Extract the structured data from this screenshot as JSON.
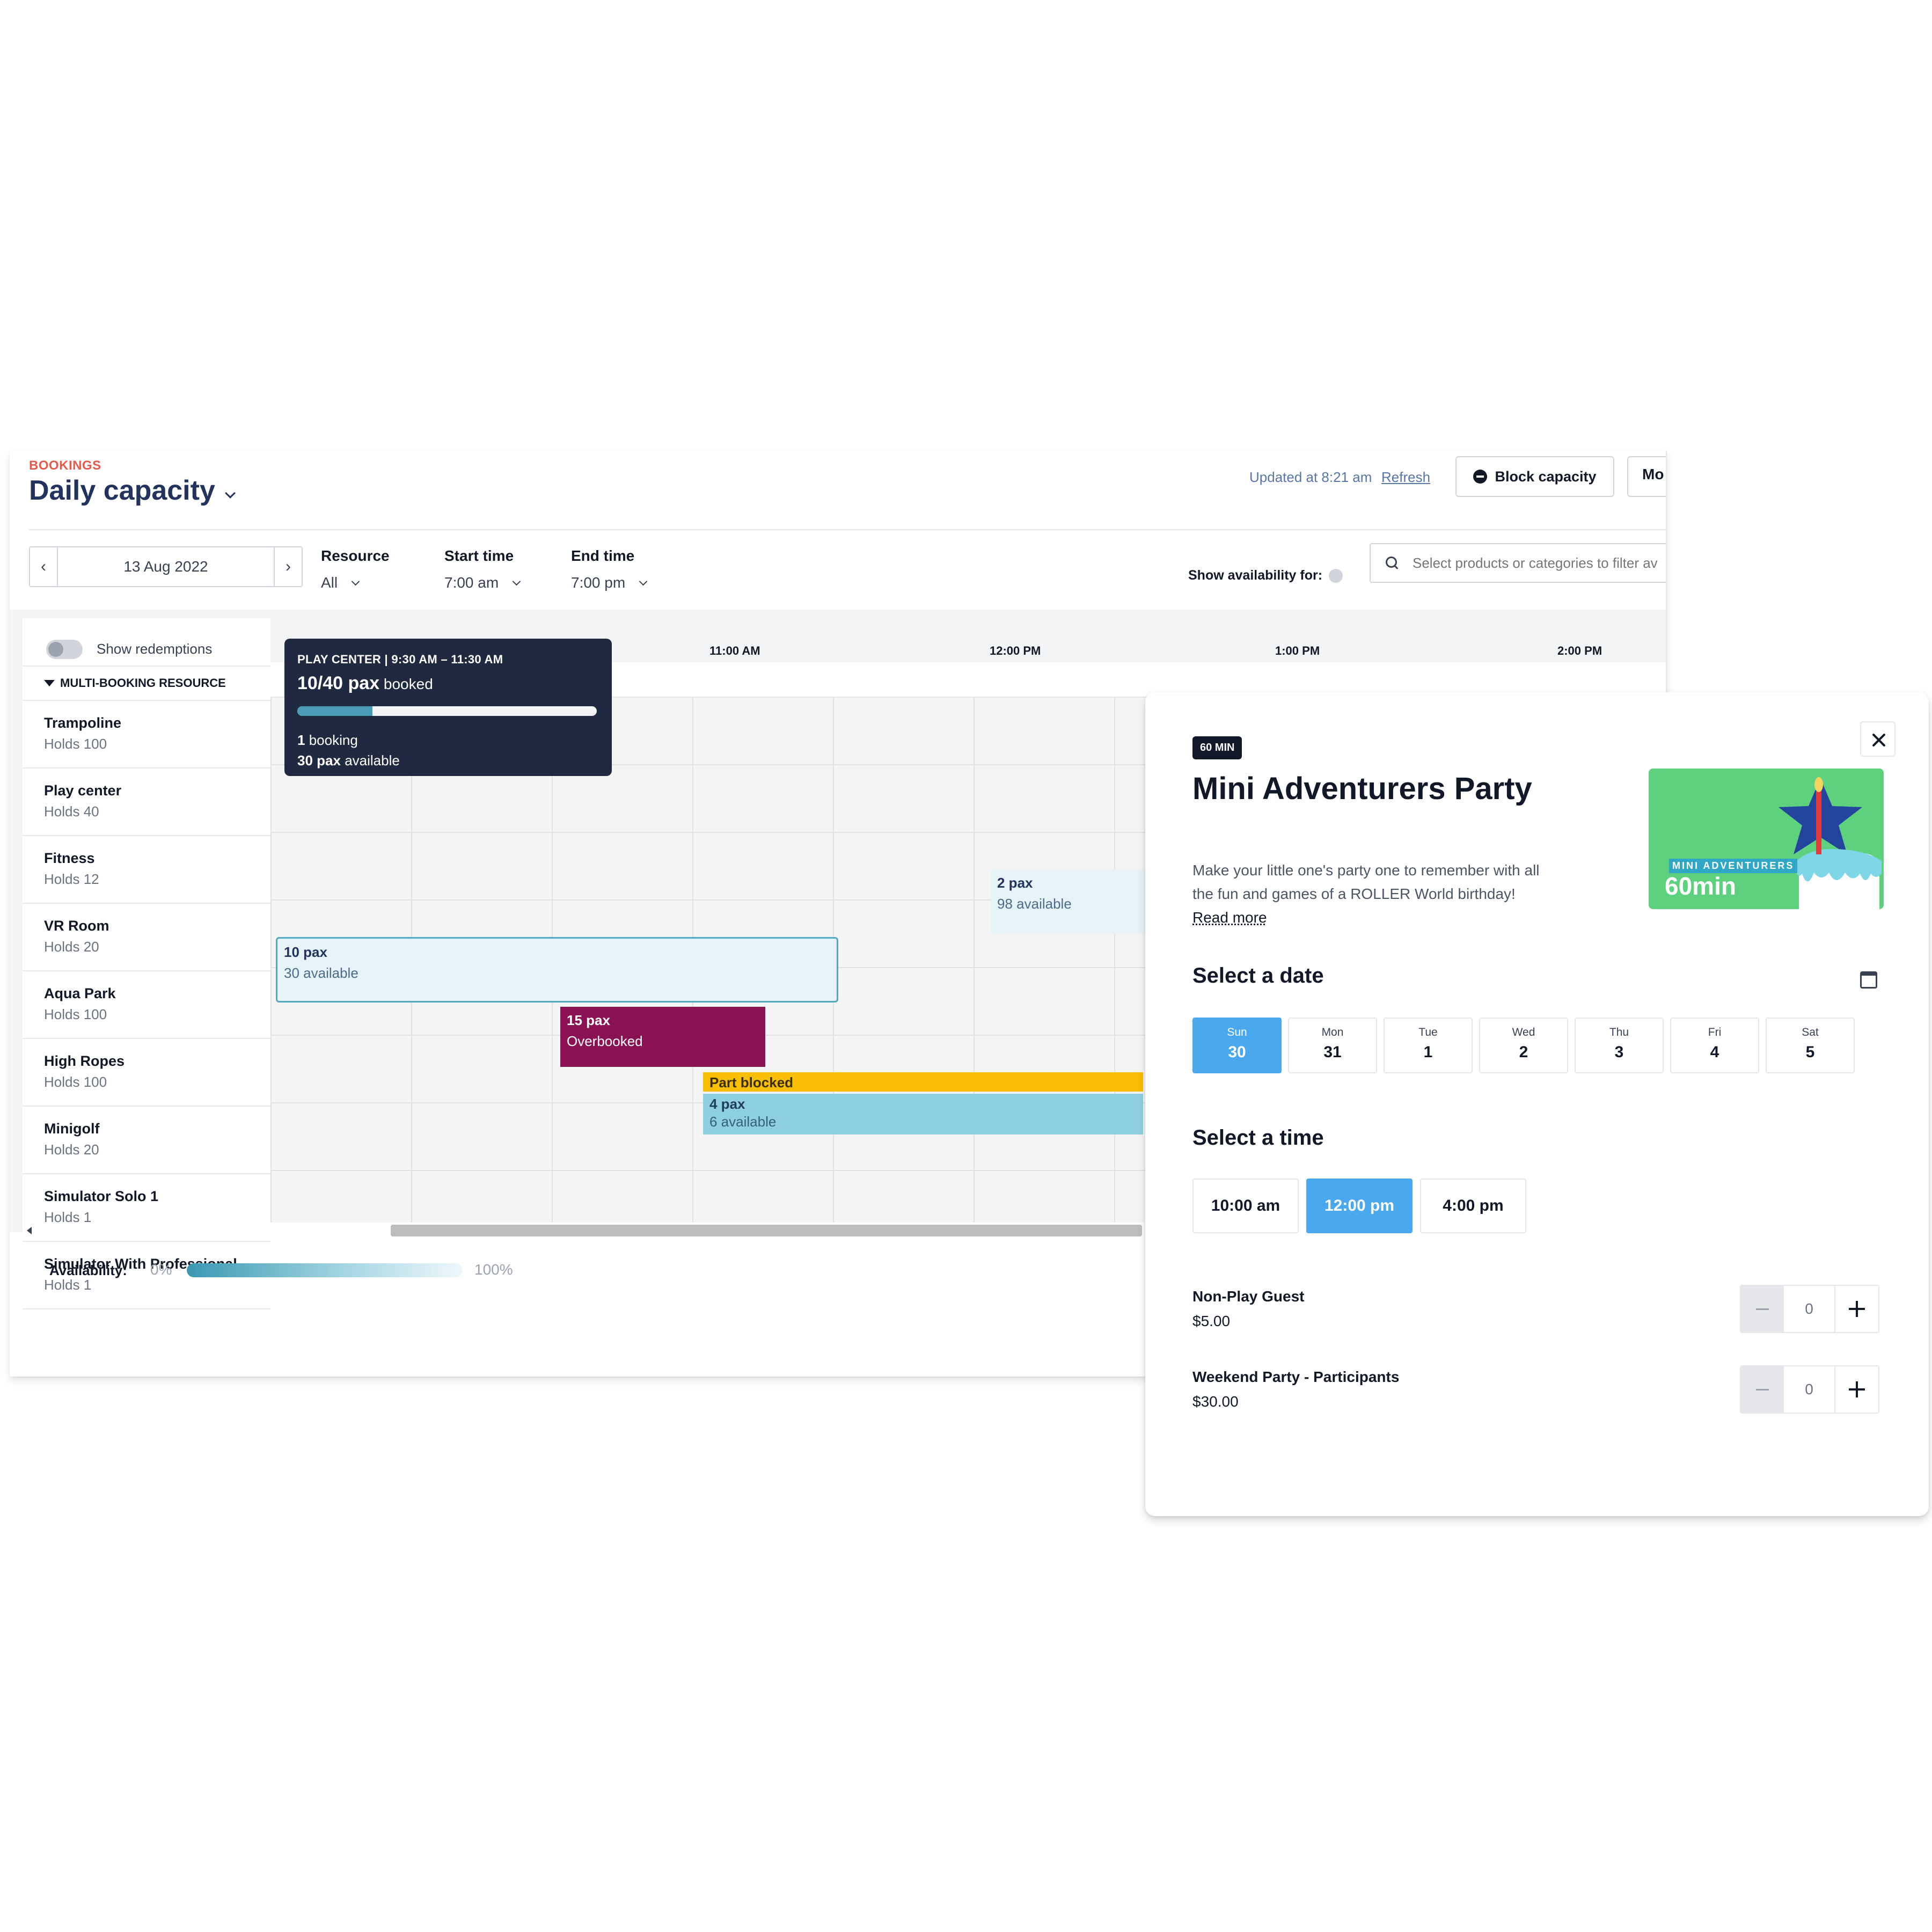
{
  "header": {
    "eyebrow": "BOOKINGS",
    "title": "Daily capacity",
    "updated": "Updated at 8:21 am",
    "refresh": "Refresh",
    "block_capacity": "Block capacity",
    "more": "Mo"
  },
  "filters": {
    "date": "13 Aug 2022",
    "resource_label": "Resource",
    "resource_value": "All",
    "start_label": "Start time",
    "start_value": "7:00 am",
    "end_label": "End time",
    "end_value": "7:00 pm",
    "show_availability": "Show availability for:",
    "search_placeholder": "Select products or categories to filter av"
  },
  "sidebar": {
    "toggle_label": "Show redemptions",
    "group": "MULTI-BOOKING RESOURCE",
    "resources": [
      {
        "name": "Trampoline",
        "capacity": "Holds 100"
      },
      {
        "name": "Play center",
        "capacity": "Holds 40"
      },
      {
        "name": "Fitness",
        "capacity": "Holds 12"
      },
      {
        "name": "VR Room",
        "capacity": "Holds 20"
      },
      {
        "name": "Aqua Park",
        "capacity": "Holds 100"
      },
      {
        "name": "High Ropes",
        "capacity": "Holds 100"
      },
      {
        "name": "Minigolf",
        "capacity": "Holds 20"
      },
      {
        "name": "Simulator Solo 1",
        "capacity": "Holds 1"
      },
      {
        "name": "Simulator With Professional",
        "capacity": "Holds 1"
      }
    ]
  },
  "timeline": {
    "labels": [
      "11:00 AM",
      "12:00 PM",
      "1:00 PM",
      "2:00 PM"
    ]
  },
  "bookings": {
    "trampoline": {
      "main": "2 pax",
      "sub": "98 available"
    },
    "play_center": {
      "main": "10 pax",
      "sub": "30 available"
    },
    "fitness": {
      "main": "15 pax",
      "sub": "Overbooked"
    },
    "vr_blocked": {
      "main": "Part blocked"
    },
    "vr_room": {
      "main": "4 pax",
      "sub": "6 available"
    }
  },
  "tooltip": {
    "title": "PLAY CENTER | 9:30 AM – 11:30 AM",
    "booked_count": "10/40 pax",
    "booked_word": "booked",
    "fill_fraction": 0.25,
    "bookings_count": "1",
    "bookings_word": "booking",
    "available_count": "30 pax",
    "available_word": "available"
  },
  "availability": {
    "label": "Availability:",
    "min": "0%",
    "max": "100%"
  },
  "modal": {
    "duration": "60 MIN",
    "title": "Mini Adventurers Party",
    "description": "Make your little one's party one to remember with all the fun and games of a ROLLER World birthday!",
    "read_more": "Read more",
    "promo_subtitle": "MINI ADVENTURERS",
    "promo_main": "60min",
    "select_date": "Select a date",
    "days": [
      {
        "name": "Sun",
        "date": "30"
      },
      {
        "name": "Mon",
        "date": "31"
      },
      {
        "name": "Tue",
        "date": "1"
      },
      {
        "name": "Wed",
        "date": "2"
      },
      {
        "name": "Thu",
        "date": "3"
      },
      {
        "name": "Fri",
        "date": "4"
      },
      {
        "name": "Sat",
        "date": "5"
      }
    ],
    "select_time": "Select a time",
    "times": [
      "10:00 am",
      "12:00 pm",
      "4:00 pm"
    ],
    "tickets": [
      {
        "name": "Non-Play Guest",
        "price": "$5.00",
        "qty": "0"
      },
      {
        "name": "Weekend Party - Participants",
        "price": "$30.00",
        "qty": "0"
      }
    ]
  },
  "colors": {
    "accent": "#4aa8ee",
    "brand_dark": "#22335d",
    "overbooked": "#8a1152",
    "part_blocked": "#f8bf05",
    "vr_block": "#8ecfe0",
    "light_block": "#e6f3f8"
  }
}
